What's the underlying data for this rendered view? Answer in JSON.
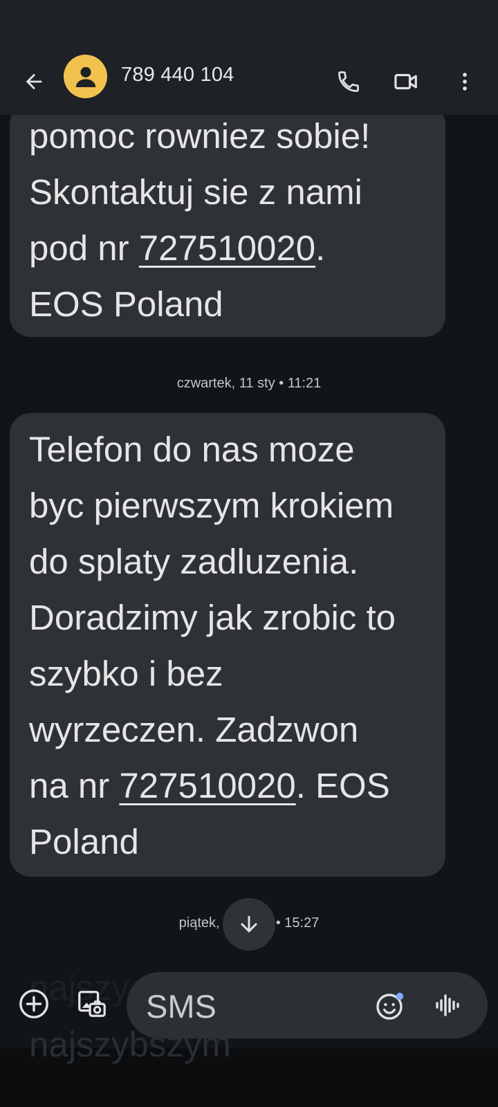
{
  "header": {
    "contact_name": "789 440 104",
    "icons": {
      "back": "arrow-back-icon",
      "avatar": "person-icon",
      "call": "phone-icon",
      "video": "video-call-icon",
      "more": "more-vert-icon"
    }
  },
  "messages": [
    {
      "lines": [
        [
          "pomoc rowniez sobie!"
        ],
        [
          "Skontaktuj sie z nami"
        ],
        [
          "pod nr ",
          {
            "link": "727510020"
          },
          "."
        ],
        [
          "EOS Poland"
        ]
      ]
    },
    {
      "timestamp": "czwartek, 11 sty • 11:21",
      "lines": [
        [
          "Telefon do nas moze"
        ],
        [
          "byc pierwszym krokiem"
        ],
        [
          "do splaty zadluzenia."
        ],
        [
          "Doradzimy jak zrobic to"
        ],
        [
          "szybko i bez"
        ],
        [
          "wyrzeczen. Zadzwon"
        ],
        [
          "na nr ",
          {
            "link": "727510020"
          },
          ". EOS"
        ],
        [
          "Poland"
        ]
      ]
    }
  ],
  "partial_timestamp": {
    "left": "piątek,",
    "right": "• 15:27"
  },
  "partial_message_text": {
    "line1": "najszy",
    "line2": "najszybszym"
  },
  "compose": {
    "placeholder": "SMS",
    "icons": {
      "add": "add-circle-icon",
      "gallery": "gallery-icon",
      "emoji": "emoji-icon",
      "voice": "voice-waveform-icon",
      "scroll_down": "arrow-down-icon"
    }
  },
  "colors": {
    "background": "#111418",
    "app_bar": "#1e2125",
    "bubble": "#2e3135",
    "avatar": "#f2c24f",
    "emoji_badge": "#7cacf8"
  }
}
